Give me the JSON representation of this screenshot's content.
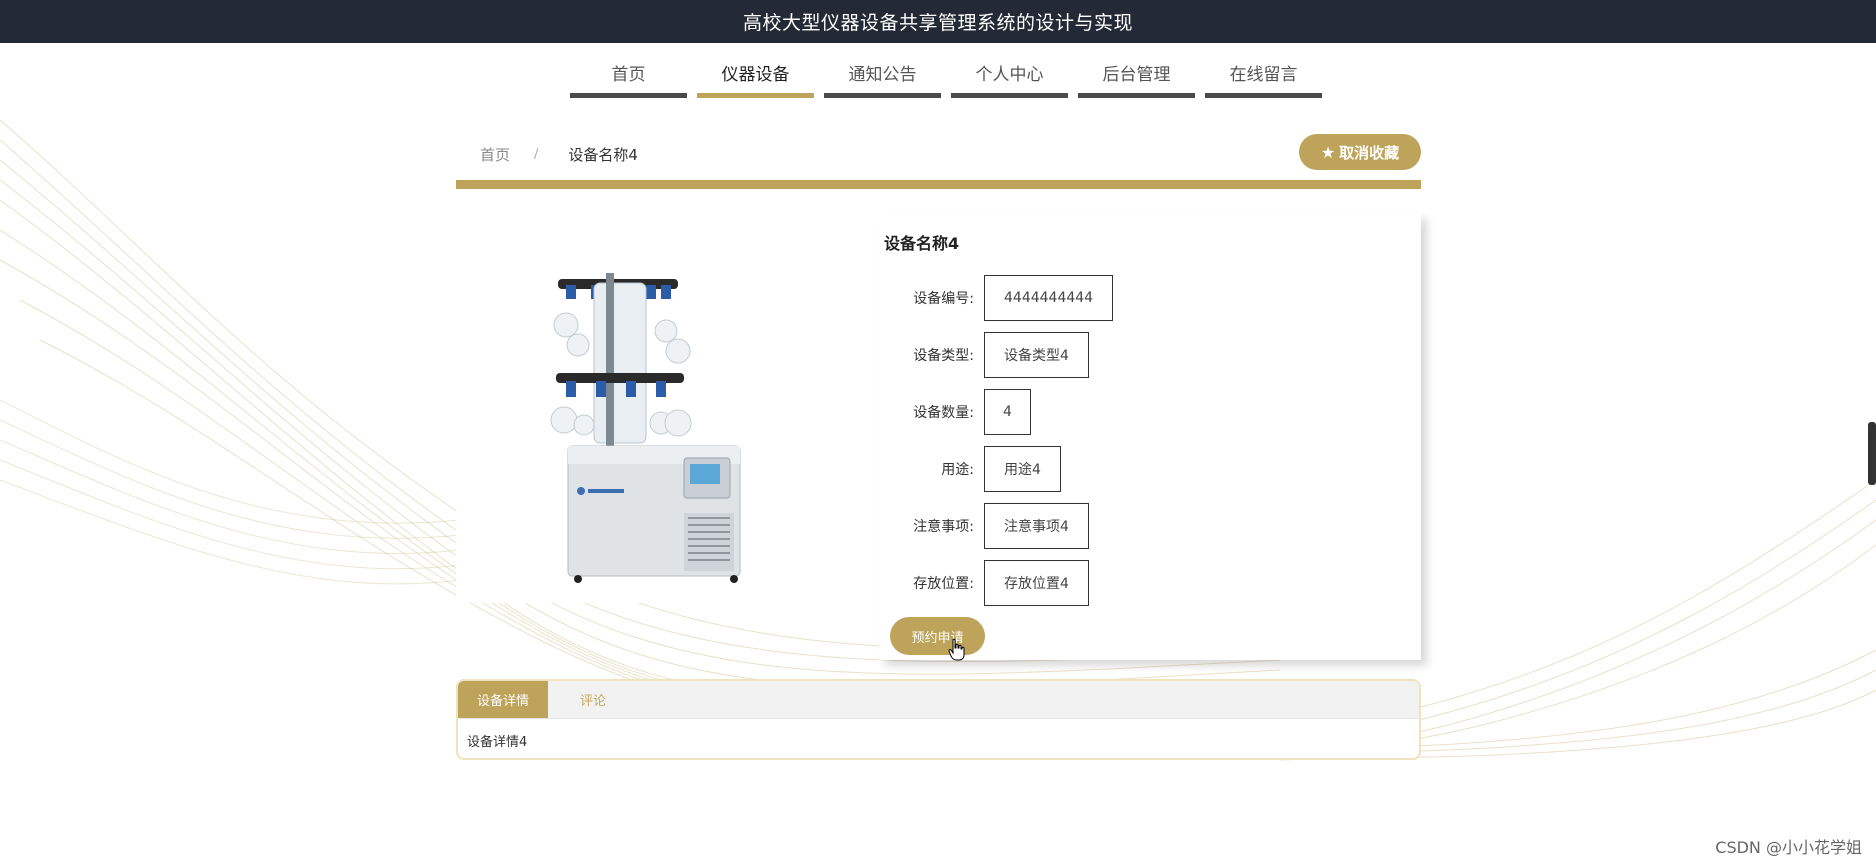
{
  "header": {
    "site_title": "高校大型仪器设备共享管理系统的设计与实现"
  },
  "nav": {
    "items": [
      {
        "label": "首页",
        "active": false
      },
      {
        "label": "仪器设备",
        "active": true
      },
      {
        "label": "通知公告",
        "active": false
      },
      {
        "label": "个人中心",
        "active": false
      },
      {
        "label": "后台管理",
        "active": false
      },
      {
        "label": "在线留言",
        "active": false
      }
    ]
  },
  "breadcrumb": {
    "home": "首页",
    "separator": "/",
    "current": "设备名称4"
  },
  "favorite_button": {
    "label": "取消收藏",
    "icon": "star-icon"
  },
  "device": {
    "name": "设备名称4",
    "fields": [
      {
        "label": "设备编号:",
        "value": "4444444444"
      },
      {
        "label": "设备类型:",
        "value": "设备类型4"
      },
      {
        "label": "设备数量:",
        "value": "4"
      },
      {
        "label": "用途:",
        "value": "用途4"
      },
      {
        "label": "注意事项:",
        "value": "注意事项4"
      },
      {
        "label": "存放位置:",
        "value": "存放位置4"
      }
    ],
    "reserve_button": "预约申请"
  },
  "tabs": {
    "items": [
      {
        "label": "设备详情",
        "active": true
      },
      {
        "label": "评论",
        "active": false
      }
    ],
    "content": "设备详情4"
  },
  "colors": {
    "accent": "#bea35a",
    "topbar": "#232a35",
    "nav_underline": "#4a4a4a"
  },
  "watermark": "CSDN @小小花学姐"
}
